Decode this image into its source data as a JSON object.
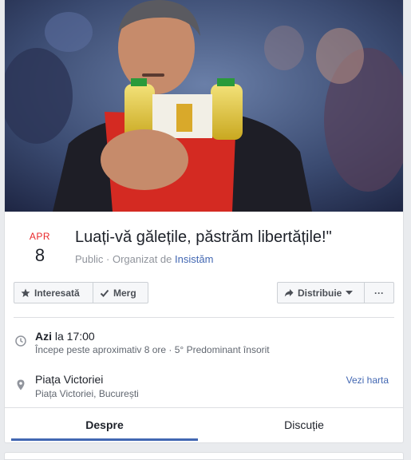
{
  "event": {
    "month": "APR",
    "day": "8",
    "title": "Luați-vă gălețile, păstrăm libertățile!\"",
    "visibility": "Public · Organizat de ",
    "organizer": "Insistăm"
  },
  "actions": {
    "interested": "Interesată",
    "going": "Merg",
    "share": "Distribuie",
    "more": "···"
  },
  "time": {
    "day_label": "Azi",
    "time_text": " la 17:00",
    "detail": "Începe peste aproximativ 8 ore · 5° Predominant însorit"
  },
  "location": {
    "name": "Piața Victoriei",
    "address": "Piața Victoriei, București",
    "map_link": "Vezi harta"
  },
  "tabs": [
    {
      "label": "Despre"
    },
    {
      "label": "Discuție"
    }
  ],
  "colors": {
    "accent": "#4267b2",
    "date_red": "#e9272a",
    "bucket_red": "#d42a22"
  }
}
